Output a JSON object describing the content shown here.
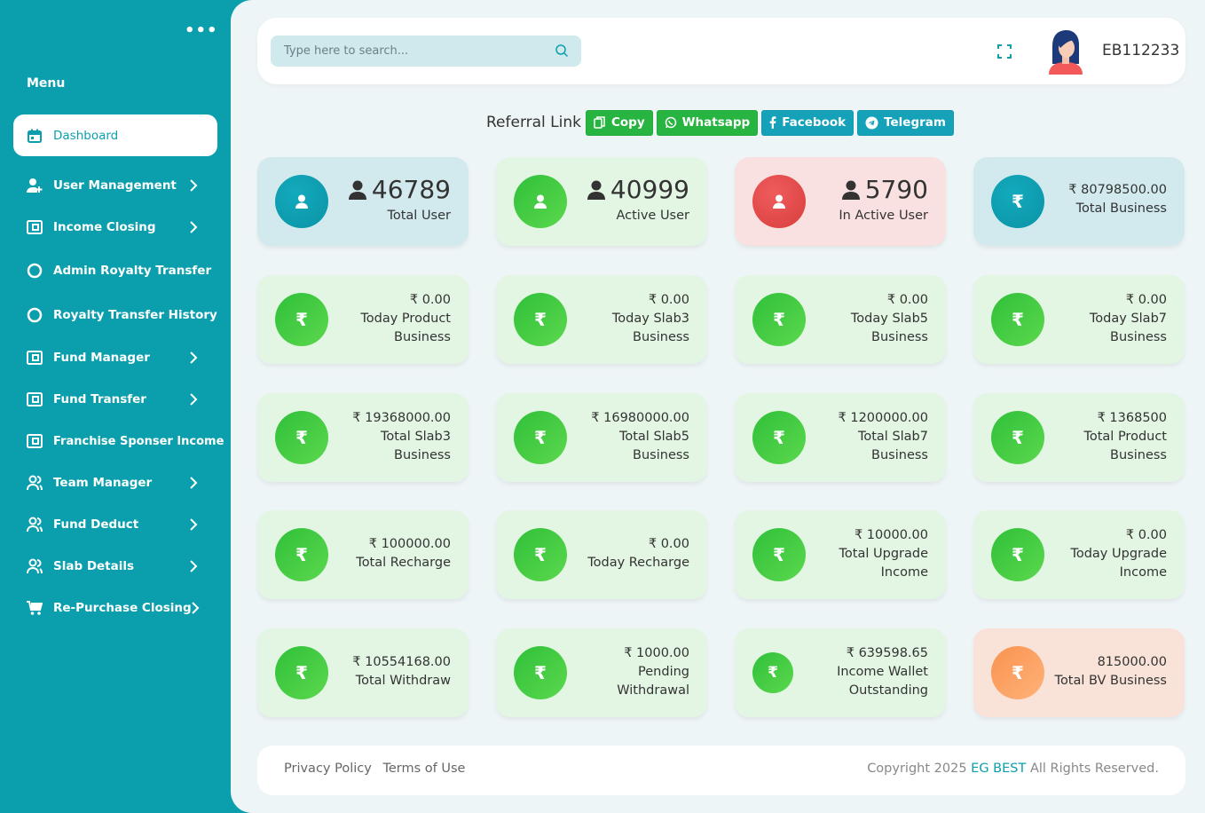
{
  "sidebar": {
    "menu_title": "Menu",
    "more_icon": "ellipsis-icon",
    "items": [
      {
        "label": "Dashboard",
        "icon": "calendar-icon"
      },
      {
        "label": "User Management",
        "icon": "user-plus-icon"
      },
      {
        "label": "Income Closing",
        "icon": "wallet-icon"
      },
      {
        "label": "Admin Royalty Transfer",
        "icon": "circle-icon"
      },
      {
        "label": "Royalty Transfer History",
        "icon": "circle-icon"
      },
      {
        "label": "Fund Manager",
        "icon": "wallet-icon"
      },
      {
        "label": "Fund Transfer",
        "icon": "wallet-icon"
      },
      {
        "label": "Franchise Sponser Income",
        "icon": "wallet-icon"
      },
      {
        "label": "Team Manager",
        "icon": "users-icon"
      },
      {
        "label": "Fund Deduct",
        "icon": "users-icon"
      },
      {
        "label": "Slab Details",
        "icon": "users-icon"
      },
      {
        "label": "Re-Purchase Closing",
        "icon": "cart-icon"
      }
    ]
  },
  "header": {
    "search_placeholder": "Type here to search...",
    "user_id": "EB112233"
  },
  "referral": {
    "label": "Referral Link",
    "copy": "Copy",
    "whatsapp": "Whatsapp",
    "facebook": "Facebook",
    "telegram": "Telegram"
  },
  "stats": {
    "total_user": {
      "value": "46789",
      "label": "Total User"
    },
    "active_user": {
      "value": "40999",
      "label": "Active User"
    },
    "inactive_user": {
      "value": "5790",
      "label": "In Active User"
    },
    "total_business": {
      "value": "₹ 80798500.00",
      "label": "Total Business"
    }
  },
  "cards": [
    {
      "value": "₹ 0.00",
      "line1": "Today Product",
      "line2": "Business"
    },
    {
      "value": "₹ 0.00",
      "line1": "Today Slab3",
      "line2": "Business"
    },
    {
      "value": "₹ 0.00",
      "line1": "Today Slab5",
      "line2": "Business"
    },
    {
      "value": "₹ 0.00",
      "line1": "Today Slab7",
      "line2": "Business"
    },
    {
      "value": "₹ 19368000.00",
      "line1": "Total Slab3",
      "line2": "Business"
    },
    {
      "value": "₹ 16980000.00",
      "line1": "Total Slab5",
      "line2": "Business"
    },
    {
      "value": "₹ 1200000.00",
      "line1": "Total Slab7",
      "line2": "Business"
    },
    {
      "value": "₹ 1368500",
      "line1": "Total Product",
      "line2": "Business"
    },
    {
      "value": "₹ 100000.00",
      "line1": "Total Recharge",
      "line2": ""
    },
    {
      "value": "₹ 0.00",
      "line1": "Today Recharge",
      "line2": ""
    },
    {
      "value": "₹ 10000.00",
      "line1": "Total Upgrade",
      "line2": "Income"
    },
    {
      "value": "₹ 0.00",
      "line1": "Today Upgrade",
      "line2": "Income"
    },
    {
      "value": "₹ 10554168.00",
      "line1": "Total Withdraw",
      "line2": ""
    },
    {
      "value": "₹ 1000.00",
      "line1": "Pending",
      "line2": "Withdrawal"
    },
    {
      "value": "₹ 639598.65",
      "line1": "Income Wallet",
      "line2": "Outstanding"
    },
    {
      "value": "815000.00",
      "line1": "Total BV Business",
      "line2": ""
    }
  ],
  "rupee_symbol": "₹",
  "footer": {
    "privacy": "Privacy Policy",
    "terms": "Terms of Use",
    "copyright_prefix": "Copyright 2025",
    "brand": "EG BEST",
    "copyright_suffix": "All Rights Reserved."
  },
  "colors": {
    "sidebar": "#0b9fae",
    "green": "#28b441",
    "teal_button": "#15a2b8",
    "red_icon": "#e04545",
    "orange_icon": "#fb9c5e"
  }
}
